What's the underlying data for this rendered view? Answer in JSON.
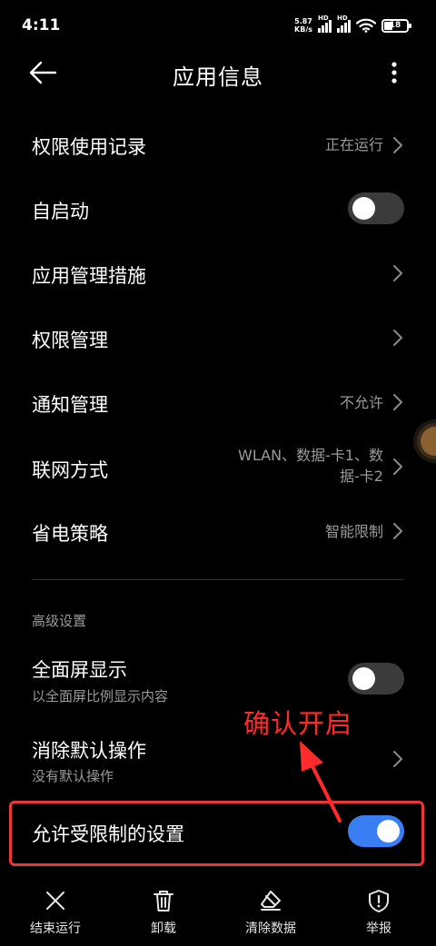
{
  "status_bar": {
    "time": "4:11",
    "net_speed_value": "5.87",
    "net_speed_unit": "KB/s",
    "hd_label": "HD",
    "battery_level": "18"
  },
  "header": {
    "title": "应用信息"
  },
  "settings": [
    {
      "title": "权限使用记录",
      "value": "正在运行",
      "chevron": true
    },
    {
      "title": "自启动",
      "toggle": false
    },
    {
      "title": "应用管理措施",
      "chevron": true
    },
    {
      "title": "权限管理",
      "chevron": true
    },
    {
      "title": "通知管理",
      "value": "不允许",
      "chevron": true
    },
    {
      "title": "联网方式",
      "value_line1": "WLAN、数据-卡1、数",
      "value_line2": "据-卡2",
      "chevron": true
    },
    {
      "title": "省电策略",
      "value": "智能限制",
      "chevron": true
    }
  ],
  "advanced": {
    "section_label": "高级设置",
    "items": [
      {
        "title": "全面屏显示",
        "subtitle": "以全面屏比例显示内容",
        "toggle": false
      },
      {
        "title": "消除默认操作",
        "subtitle": "没有默认操作",
        "chevron": true
      },
      {
        "title": "允许受限制的设置",
        "toggle": true
      }
    ]
  },
  "annotation": {
    "text": "确认开启",
    "color": "#ff2a2a",
    "highlight_color": "#e8383a"
  },
  "bottom_actions": [
    {
      "label": "结束运行",
      "icon": "close-icon"
    },
    {
      "label": "卸载",
      "icon": "trash-icon"
    },
    {
      "label": "清除数据",
      "icon": "eraser-icon"
    },
    {
      "label": "举报",
      "icon": "shield-alert-icon"
    }
  ],
  "colors": {
    "background": "#000000",
    "toggle_on": "#3a7ef3",
    "toggle_off": "#3b3b3b",
    "secondary_text": "#9a9a9a"
  }
}
